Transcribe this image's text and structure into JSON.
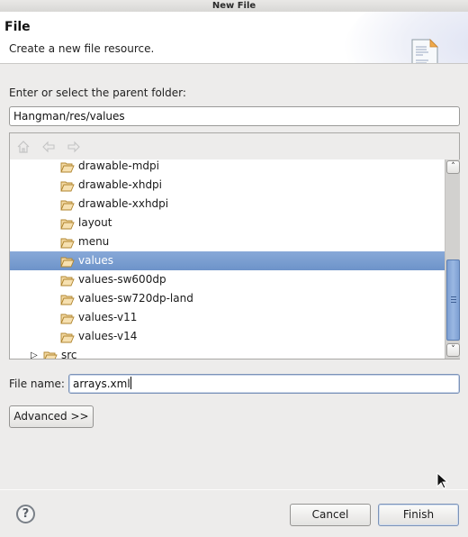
{
  "window": {
    "title": "New File"
  },
  "banner": {
    "title": "File",
    "description": "Create a new file resource.",
    "icon": "new-file-document-icon"
  },
  "parent_folder": {
    "label": "Enter or select the parent folder:",
    "value": "Hangman/res/values"
  },
  "tree_toolbar": {
    "home_icon": "home-icon",
    "back_icon": "back-arrow-icon",
    "forward_icon": "forward-arrow-icon"
  },
  "tree": {
    "items": [
      {
        "label": "drawable-mdpi",
        "level": 2,
        "selected": false
      },
      {
        "label": "drawable-xhdpi",
        "level": 2,
        "selected": false
      },
      {
        "label": "drawable-xxhdpi",
        "level": 2,
        "selected": false
      },
      {
        "label": "layout",
        "level": 2,
        "selected": false
      },
      {
        "label": "menu",
        "level": 2,
        "selected": false
      },
      {
        "label": "values",
        "level": 2,
        "selected": true
      },
      {
        "label": "values-sw600dp",
        "level": 2,
        "selected": false
      },
      {
        "label": "values-sw720dp-land",
        "level": 2,
        "selected": false
      },
      {
        "label": "values-v11",
        "level": 2,
        "selected": false
      },
      {
        "label": "values-v14",
        "level": 2,
        "selected": false
      },
      {
        "label": "src",
        "level": 1,
        "selected": false,
        "expandable": true
      }
    ],
    "selection_color": "#7a9dd0"
  },
  "file_name": {
    "label": "File name:",
    "value": "arrays.xml"
  },
  "advanced_button": {
    "label": "Advanced >>"
  },
  "footer": {
    "help_icon": "?",
    "cancel_label": "Cancel",
    "finish_label": "Finish"
  }
}
